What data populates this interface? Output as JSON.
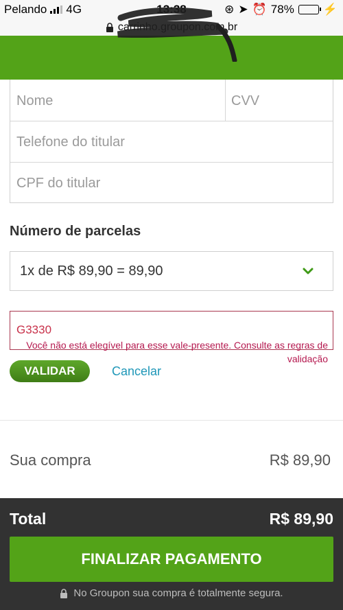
{
  "status_bar": {
    "carrier": "Pelando",
    "network": "4G",
    "time": "13:38",
    "battery": "78%",
    "battery_level": 0.78
  },
  "url_bar": {
    "url": "carrinho.groupon.com.br"
  },
  "form": {
    "name_placeholder": "Nome",
    "cvv_placeholder": "CVV",
    "phone_placeholder": "Telefone do titular",
    "cpf_placeholder": "CPF do titular"
  },
  "installments": {
    "title": "Número de parcelas",
    "selected": "1x de R$ 89,90 = 89,90"
  },
  "voucher": {
    "code": "G3330",
    "error_message": "Você não está elegível para esse vale-presente. Consulte as regras de validação",
    "validate_label": "VALIDAR",
    "cancel_label": "Cancelar"
  },
  "summary": {
    "purchase_label": "Sua compra",
    "purchase_value": "R$ 89,90"
  },
  "footer": {
    "total_label": "Total",
    "total_value": "R$ 89,90",
    "finish_label": "FINALIZAR PAGAMENTO",
    "secure_note": "No Groupon sua compra é totalmente segura."
  },
  "colors": {
    "brand_green": "#53a318",
    "error": "#c8314a",
    "link": "#1f97b8",
    "footer_bg": "#323232"
  }
}
